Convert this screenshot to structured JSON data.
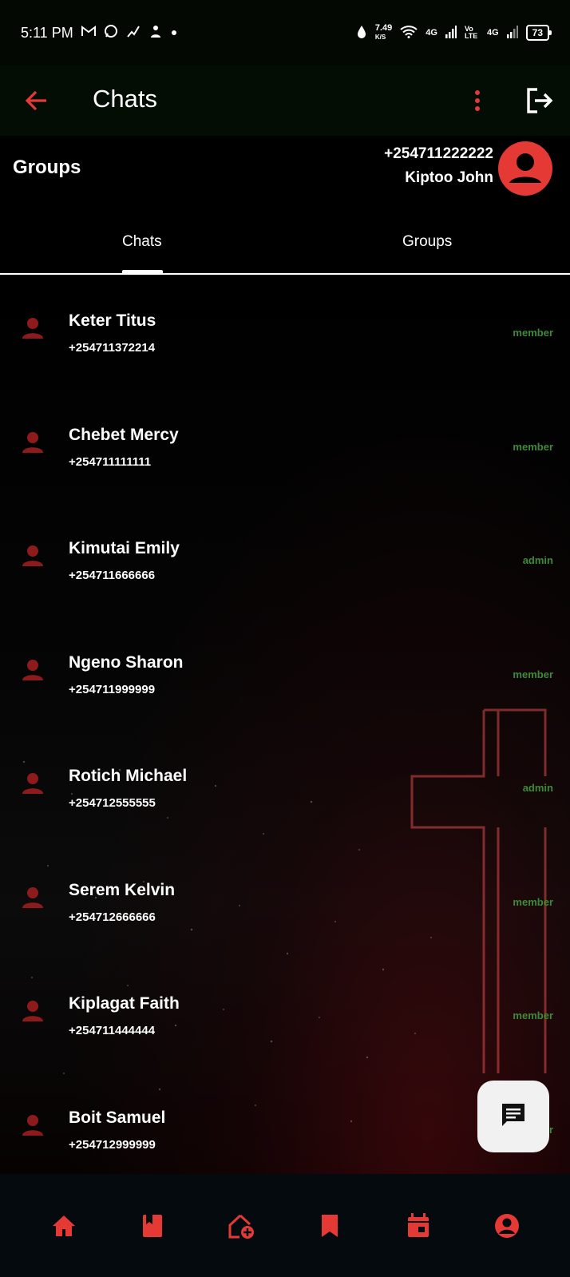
{
  "status_bar": {
    "time": "5:11 PM",
    "notification_icons": [
      "gmail-icon",
      "whatsapp-icon",
      "activity-icon",
      "people-icon",
      "dot-icon"
    ],
    "speed_value": "7.49",
    "speed_unit": "K/S",
    "network_1": "4G",
    "volte": "Vo LTE",
    "network_2": "4G",
    "battery": "73"
  },
  "app_bar": {
    "title": "Chats",
    "icons": [
      "back-arrow-icon",
      "more-vertical-icon",
      "logout-icon"
    ]
  },
  "profile_header": {
    "heading": "Groups",
    "phone": "+254711222222",
    "name": "Kiptoo John"
  },
  "tabs": [
    {
      "label": "Chats",
      "selected": true
    },
    {
      "label": "Groups",
      "selected": false
    }
  ],
  "contacts": [
    {
      "name": "Keter Titus",
      "phone": "+254711372214",
      "role": "member"
    },
    {
      "name": "Chebet Mercy",
      "phone": "+254711111111",
      "role": "member"
    },
    {
      "name": "Kimutai Emily",
      "phone": "+254711666666",
      "role": "admin"
    },
    {
      "name": "Ngeno Sharon",
      "phone": "+254711999999",
      "role": "member"
    },
    {
      "name": "Rotich Michael",
      "phone": "+254712555555",
      "role": "admin"
    },
    {
      "name": "Serem Kelvin",
      "phone": "+254712666666",
      "role": "member"
    },
    {
      "name": "Kiplagat Faith",
      "phone": "+254711444444",
      "role": "member"
    },
    {
      "name": "Boit Samuel",
      "phone": "+254712999999",
      "role": "member"
    }
  ],
  "fab": {
    "icon": "new-chat-icon"
  },
  "bottom_nav": [
    "home-icon",
    "book-icon",
    "add-church-icon",
    "bookmark-icon",
    "calendar-icon",
    "account-icon"
  ],
  "colors": {
    "accent_red": "#e53935",
    "dark_red": "#8e1b1b",
    "role_green": "#3e8a3a",
    "nav_background": "#040a0e",
    "fab_background": "#f1f1f1"
  }
}
